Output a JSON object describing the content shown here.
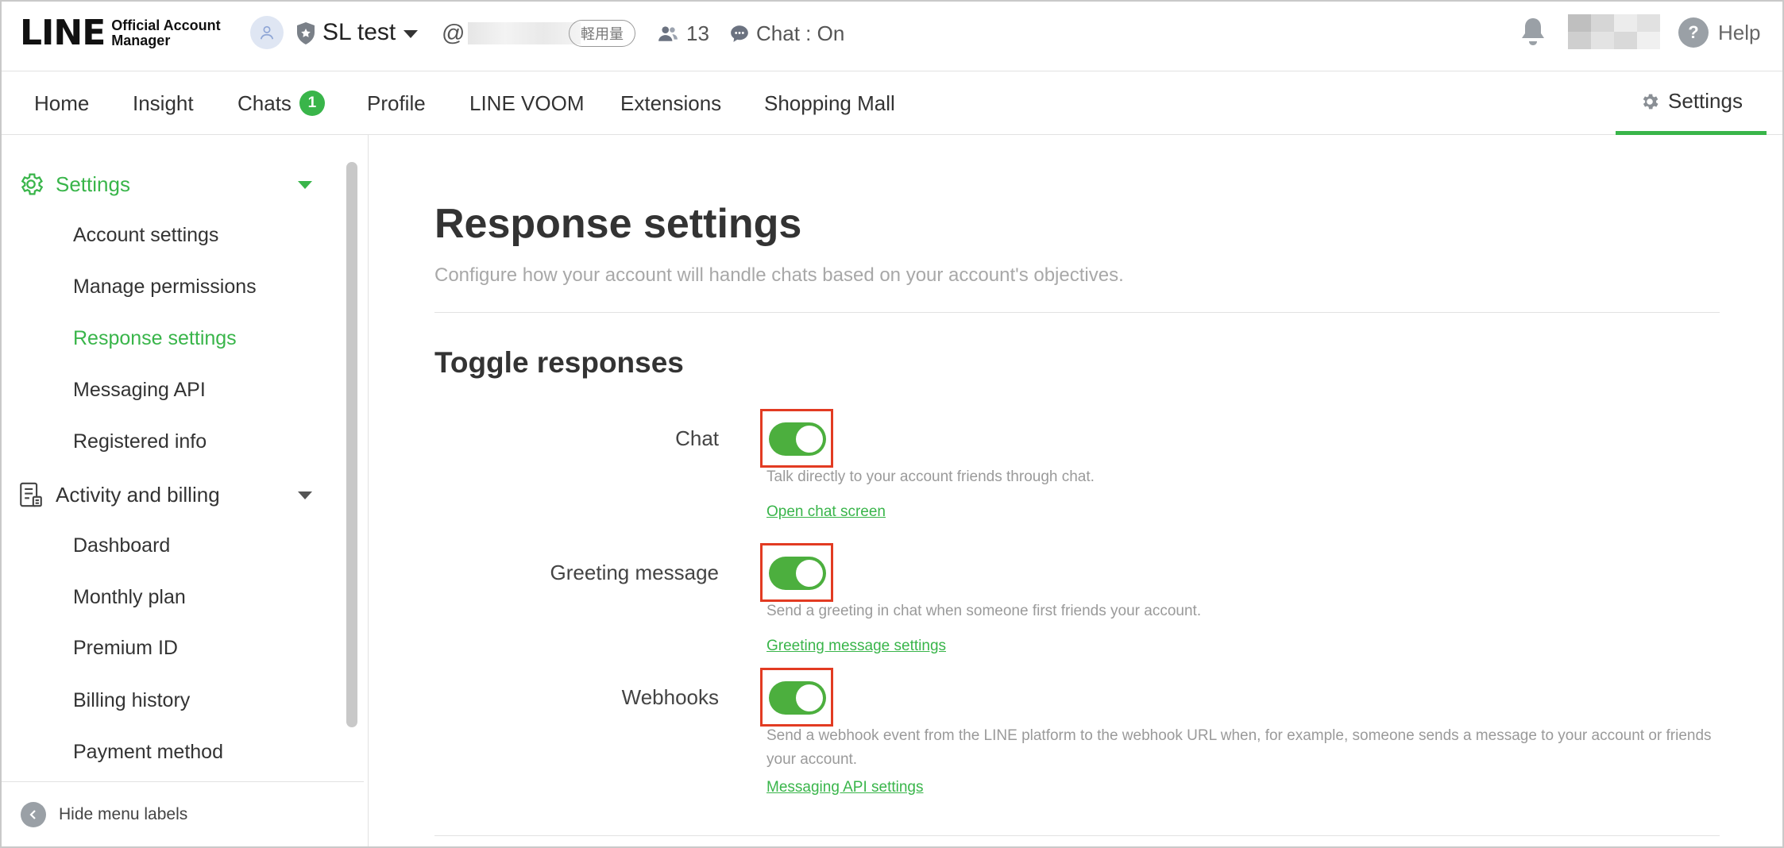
{
  "header": {
    "logo_main": "LINE",
    "logo_sub_line1": "Official Account",
    "logo_sub_line2": "Manager",
    "account_name": "SL test",
    "account_id_prefix": "@",
    "plan_badge": "軽用量",
    "friend_count": "13",
    "chat_status": "Chat : On",
    "help_label": "Help"
  },
  "nav": {
    "home": "Home",
    "insight": "Insight",
    "chats": "Chats",
    "chats_badge": "1",
    "profile": "Profile",
    "voom": "LINE VOOM",
    "extensions": "Extensions",
    "shopping": "Shopping Mall",
    "settings": "Settings"
  },
  "sidebar": {
    "settings_group": "Settings",
    "settings_items": [
      "Account settings",
      "Manage permissions",
      "Response settings",
      "Messaging API",
      "Registered info"
    ],
    "billing_group": "Activity and billing",
    "billing_items": [
      "Dashboard",
      "Monthly plan",
      "Premium ID",
      "Billing history",
      "Payment method"
    ],
    "hide_labels": "Hide menu labels"
  },
  "main": {
    "title": "Response settings",
    "description": "Configure how your account will handle chats based on your account's objectives.",
    "section_title": "Toggle responses",
    "toggles": [
      {
        "label": "Chat",
        "on": true,
        "description": "Talk directly to your account friends through chat.",
        "link": "Open chat screen"
      },
      {
        "label": "Greeting message",
        "on": true,
        "description": "Send a greeting in chat when someone first friends your account.",
        "link": "Greeting message settings"
      },
      {
        "label": "Webhooks",
        "on": true,
        "description": "Send a webhook event from the LINE platform to the webhook URL when, for example, someone sends a message to your account or friends your account.",
        "link": "Messaging API settings"
      }
    ]
  },
  "colors": {
    "accent_green": "#39b54a",
    "toggle_green": "#4caf3e",
    "highlight_red": "#e23b22"
  }
}
